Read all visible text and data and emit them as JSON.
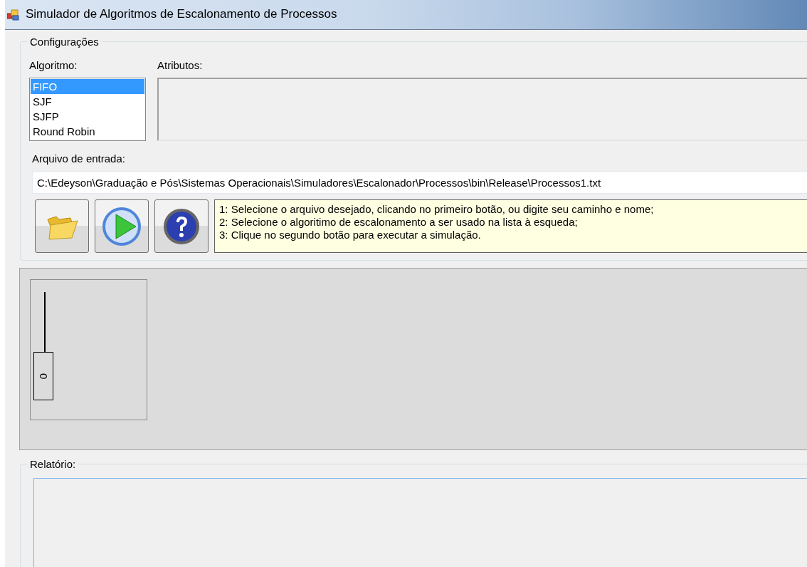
{
  "window": {
    "title": "Simulador de Algoritmos de Escalonamento de Processos"
  },
  "config": {
    "legend": "Configurações",
    "algorithm_label": "Algoritmo:",
    "algorithms": [
      {
        "label": "FIFO",
        "selected": true
      },
      {
        "label": "SJF",
        "selected": false
      },
      {
        "label": "SJFP",
        "selected": false
      },
      {
        "label": "Round Robin",
        "selected": false
      }
    ],
    "attributes_label": "Atributos:",
    "file_label": "Arquivo de entrada:",
    "file_path": "C:\\Edeyson\\Graduação e Pós\\Sistemas Operacionais\\Simuladores\\Escalonador\\Processos\\bin\\Release\\Processos1.txt",
    "buttons": [
      {
        "kind": "open"
      },
      {
        "kind": "run"
      },
      {
        "kind": "help"
      }
    ],
    "instructions": [
      "1: Selecione o arquivo desejado, clicando no primeiro botão, ou digite seu caminho e nome;",
      "2: Selecione o algoritimo de escalonamento a ser usado na lista à esqueda;",
      "3: Clique no segundo botão para executar a simulação."
    ]
  },
  "simulation": {
    "process_label": "0"
  },
  "report": {
    "legend": "Relatório:"
  }
}
